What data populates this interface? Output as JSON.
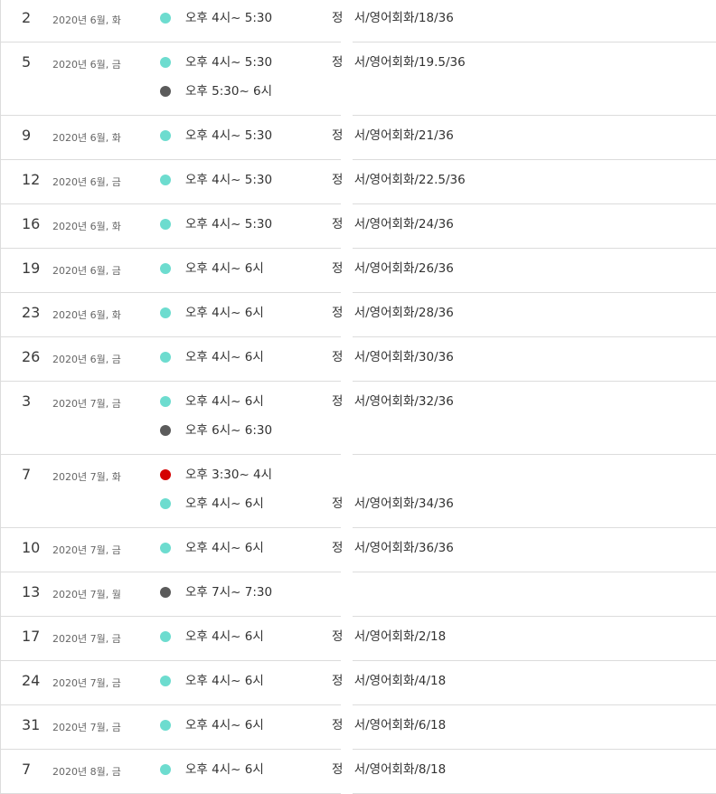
{
  "colors": {
    "teal": "#6ddccf",
    "gray": "#5b5b5b",
    "red": "#d40000"
  },
  "days": [
    {
      "num": "2",
      "date": "2020년 6월, 화",
      "events": [
        {
          "time": "오후 4시~ 5:30",
          "title": "정 서/영어회화/18/36",
          "color": "teal"
        }
      ]
    },
    {
      "num": "5",
      "date": "2020년 6월, 금",
      "events": [
        {
          "time": "오후 4시~ 5:30",
          "title": "정 서/영어회화/19.5/36",
          "color": "teal"
        },
        {
          "time": "오후 5:30~ 6시",
          "title": "",
          "color": "gray"
        }
      ]
    },
    {
      "num": "9",
      "date": "2020년 6월, 화",
      "events": [
        {
          "time": "오후 4시~ 5:30",
          "title": "정 서/영어회화/21/36",
          "color": "teal"
        }
      ]
    },
    {
      "num": "12",
      "date": "2020년 6월, 금",
      "events": [
        {
          "time": "오후 4시~ 5:30",
          "title": "정 서/영어회화/22.5/36",
          "color": "teal"
        }
      ]
    },
    {
      "num": "16",
      "date": "2020년 6월, 화",
      "events": [
        {
          "time": "오후 4시~ 5:30",
          "title": "정 서/영어회화/24/36",
          "color": "teal"
        }
      ]
    },
    {
      "num": "19",
      "date": "2020년 6월, 금",
      "events": [
        {
          "time": "오후 4시~ 6시",
          "title": "정 서/영어회화/26/36",
          "color": "teal"
        }
      ]
    },
    {
      "num": "23",
      "date": "2020년 6월, 화",
      "events": [
        {
          "time": "오후 4시~ 6시",
          "title": "정 서/영어회화/28/36",
          "color": "teal"
        }
      ]
    },
    {
      "num": "26",
      "date": "2020년 6월, 금",
      "events": [
        {
          "time": "오후 4시~ 6시",
          "title": "정 서/영어회화/30/36",
          "color": "teal"
        }
      ]
    },
    {
      "num": "3",
      "date": "2020년 7월, 금",
      "events": [
        {
          "time": "오후 4시~ 6시",
          "title": "정 서/영어회화/32/36",
          "color": "teal"
        },
        {
          "time": "오후 6시~ 6:30",
          "title": "",
          "color": "gray"
        }
      ]
    },
    {
      "num": "7",
      "date": "2020년 7월, 화",
      "events": [
        {
          "time": "오후 3:30~ 4시",
          "title": "",
          "color": "red"
        },
        {
          "time": "오후 4시~ 6시",
          "title": "정 서/영어회화/34/36",
          "color": "teal"
        }
      ]
    },
    {
      "num": "10",
      "date": "2020년 7월, 금",
      "events": [
        {
          "time": "오후 4시~ 6시",
          "title": "정 서/영어회화/36/36",
          "color": "teal"
        }
      ]
    },
    {
      "num": "13",
      "date": "2020년 7월, 월",
      "events": [
        {
          "time": "오후 7시~ 7:30",
          "title": "",
          "color": "gray"
        }
      ]
    },
    {
      "num": "17",
      "date": "2020년 7월, 금",
      "events": [
        {
          "time": "오후 4시~ 6시",
          "title": "정 서/영어회화/2/18",
          "color": "teal"
        }
      ]
    },
    {
      "num": "24",
      "date": "2020년 7월, 금",
      "events": [
        {
          "time": "오후 4시~ 6시",
          "title": "정 서/영어회화/4/18",
          "color": "teal"
        }
      ]
    },
    {
      "num": "31",
      "date": "2020년 7월, 금",
      "events": [
        {
          "time": "오후 4시~ 6시",
          "title": "정 서/영어회화/6/18",
          "color": "teal"
        }
      ]
    },
    {
      "num": "7",
      "date": "2020년 8월, 금",
      "events": [
        {
          "time": "오후 4시~ 6시",
          "title": "정 서/영어회화/8/18",
          "color": "teal"
        }
      ]
    }
  ]
}
